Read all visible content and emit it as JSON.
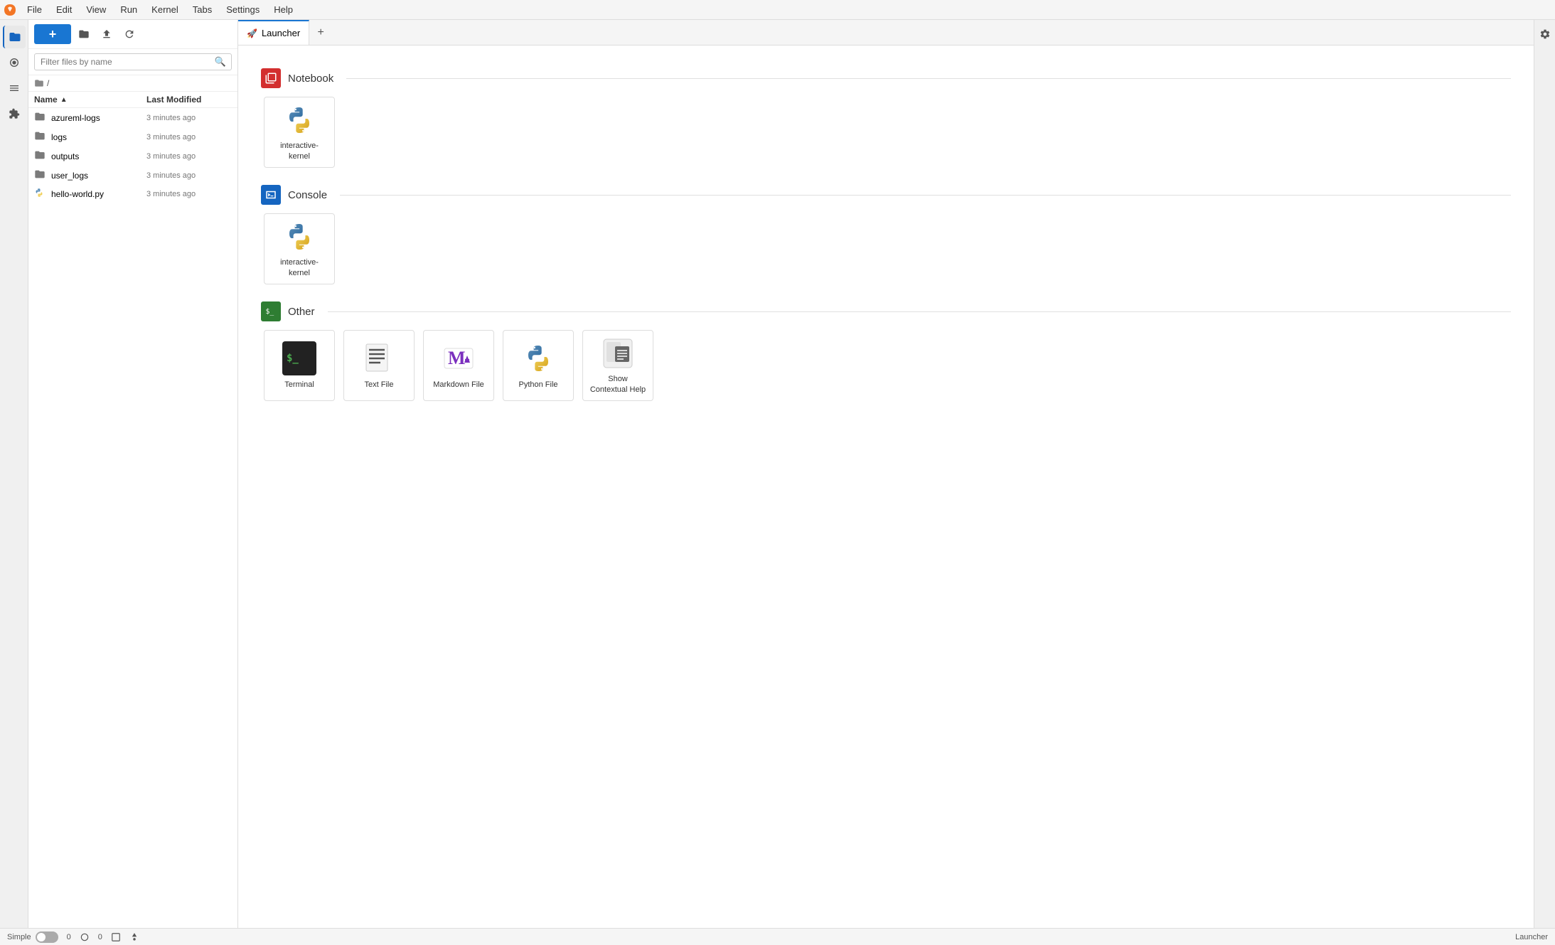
{
  "app": {
    "title": "JupyterLab"
  },
  "menubar": {
    "items": [
      "File",
      "Edit",
      "View",
      "Run",
      "Kernel",
      "Tabs",
      "Settings",
      "Help"
    ]
  },
  "sidebar_icons": [
    {
      "name": "files-icon",
      "symbol": "📁",
      "active": true
    },
    {
      "name": "running-icon",
      "symbol": "⏺"
    },
    {
      "name": "commands-icon",
      "symbol": "☰"
    },
    {
      "name": "extensions-icon",
      "symbol": "🔧"
    }
  ],
  "file_panel": {
    "new_button": "+",
    "search_placeholder": "Filter files by name",
    "breadcrumb": "/",
    "columns": {
      "name": "Name",
      "modified": "Last Modified"
    },
    "files": [
      {
        "icon": "folder",
        "name": "azureml-logs",
        "modified": "3 minutes ago"
      },
      {
        "icon": "folder",
        "name": "logs",
        "modified": "3 minutes ago"
      },
      {
        "icon": "folder",
        "name": "outputs",
        "modified": "3 minutes ago"
      },
      {
        "icon": "folder",
        "name": "user_logs",
        "modified": "3 minutes ago"
      },
      {
        "icon": "python",
        "name": "hello-world.py",
        "modified": "3 minutes ago"
      }
    ]
  },
  "tabs": [
    {
      "label": "Launcher",
      "active": true,
      "icon": "launcher-icon"
    }
  ],
  "launcher": {
    "sections": [
      {
        "id": "notebook",
        "icon": "notebook-icon",
        "icon_color": "#d32f2f",
        "title": "Notebook",
        "cards": [
          {
            "id": "interactive-kernel-notebook",
            "label": "interactive-\nkernel",
            "icon": "python-icon"
          }
        ]
      },
      {
        "id": "console",
        "icon": "console-icon",
        "icon_color": "#1565c0",
        "title": "Console",
        "cards": [
          {
            "id": "interactive-kernel-console",
            "label": "interactive-\nkernel",
            "icon": "python-icon"
          }
        ]
      },
      {
        "id": "other",
        "icon": "other-icon",
        "icon_color": "#2e7d32",
        "title": "Other",
        "cards": [
          {
            "id": "terminal",
            "label": "Terminal",
            "icon": "terminal-icon"
          },
          {
            "id": "text-file",
            "label": "Text File",
            "icon": "text-icon"
          },
          {
            "id": "markdown-file",
            "label": "Markdown File",
            "icon": "markdown-icon"
          },
          {
            "id": "python-file",
            "label": "Python File",
            "icon": "python-file-icon"
          },
          {
            "id": "contextual-help",
            "label": "Show Contextual Help",
            "icon": "help-icon"
          }
        ]
      }
    ]
  },
  "status_bar": {
    "mode": "Simple",
    "kernel_count": "0",
    "terminal_count": "0",
    "right_label": "Launcher"
  }
}
